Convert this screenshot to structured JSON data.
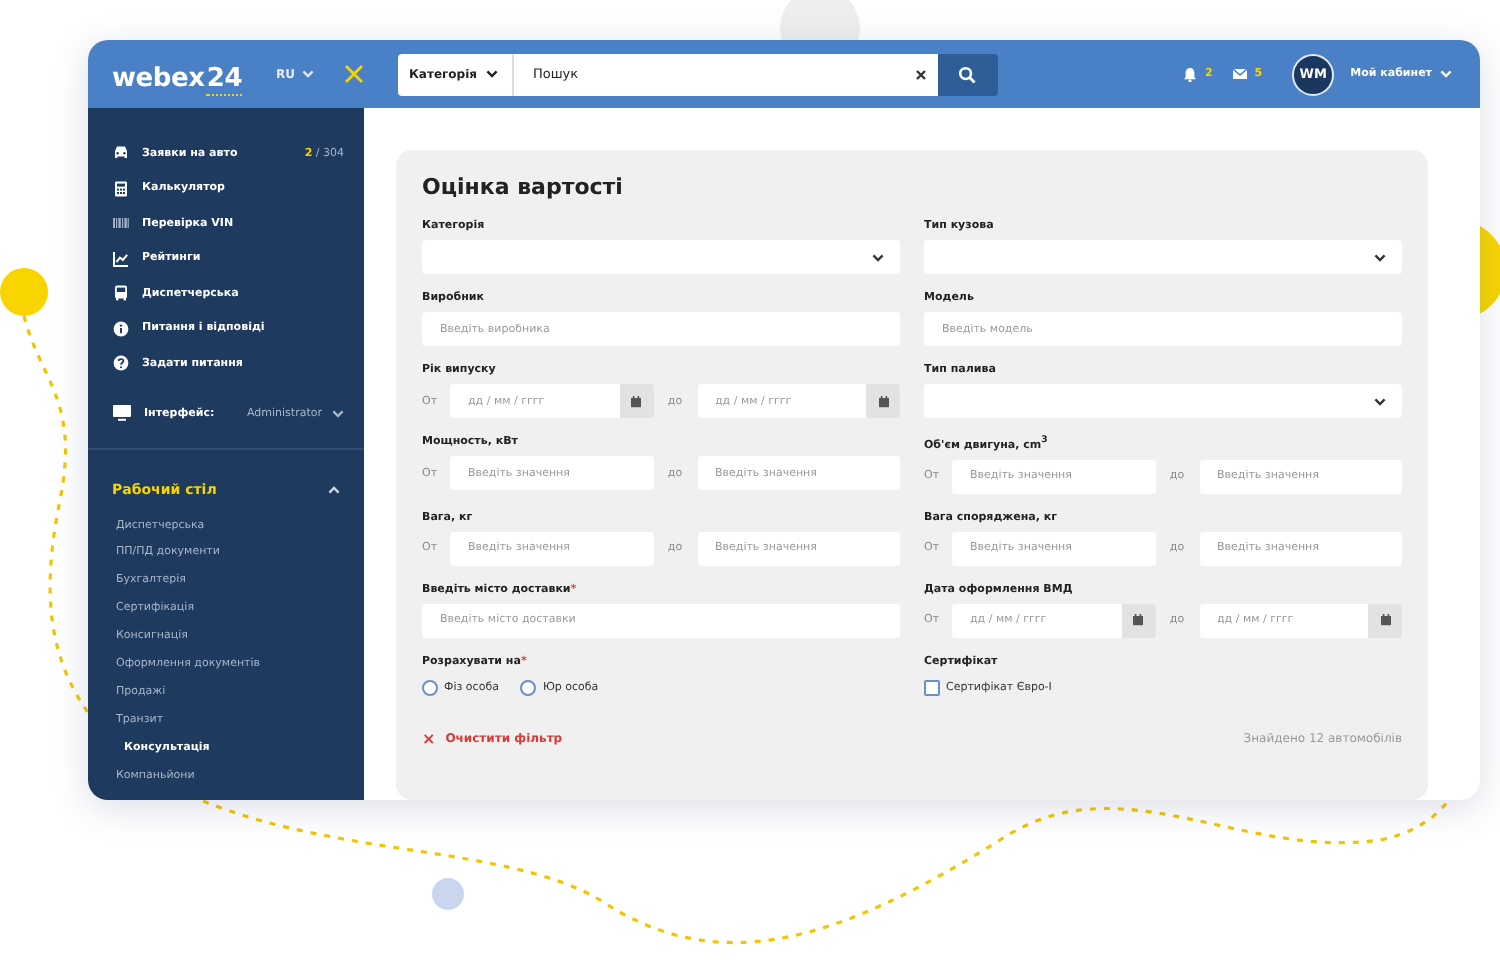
{
  "header": {
    "logo": {
      "text": "webex",
      "accent": "24"
    },
    "language": "RU",
    "search": {
      "category": "Категорія",
      "placeholder": "Пошук"
    },
    "notifications": [
      {
        "kind": "bell",
        "count": "2"
      },
      {
        "kind": "mail",
        "count": "5"
      }
    ],
    "user": {
      "initials": "WM",
      "label": "Мой кабинет"
    }
  },
  "sidebar": {
    "items": [
      {
        "label": "Заявки на авто",
        "count": "2",
        "total": "/ 304"
      },
      {
        "label": "Калькулятор"
      },
      {
        "label": "Перевірка VIN"
      },
      {
        "label": "Рейтинги"
      },
      {
        "label": "Диспетчерська"
      },
      {
        "label": "Питання і відповіді"
      },
      {
        "label": "Задати питання"
      }
    ],
    "interface": {
      "label": "Інтерфейс:",
      "value": "Administrator"
    },
    "section": {
      "title": "Рабочий стіл",
      "expanded": true,
      "items": [
        {
          "label": "Диспетчерська",
          "selected": false
        },
        {
          "label": "ПП/ПД документи",
          "selected": false
        },
        {
          "label": "Бухгалтерія",
          "selected": false
        },
        {
          "label": "Сертифікація",
          "selected": false
        },
        {
          "label": "Консигнація",
          "selected": false
        },
        {
          "label": "Оформлення документів",
          "selected": false
        },
        {
          "label": "Продажі",
          "selected": false
        },
        {
          "label": "Транзит",
          "selected": false
        },
        {
          "label": "Консультація",
          "selected": true
        },
        {
          "label": "Компаньйони",
          "selected": false
        }
      ]
    }
  },
  "form": {
    "title": "Оцінка вартості",
    "fields": [
      {
        "kind": "select",
        "label": "Категорія"
      },
      {
        "kind": "select",
        "label": "Тип кузова"
      },
      {
        "kind": "text",
        "label": "Виробник",
        "placeholder": "Введіть виробника"
      },
      {
        "kind": "text",
        "label": "Модель",
        "placeholder": "Введіть модель"
      },
      {
        "kind": "date-range",
        "label": "Рік випуску",
        "from_label": "От",
        "to_label": "до",
        "from_placeholder": "дд / мм / гггг",
        "to_placeholder": "дд / мм / гггг"
      },
      {
        "kind": "select",
        "label": "Тип палива"
      },
      {
        "kind": "range",
        "label": "Мощность, кВт",
        "from_label": "От",
        "to_label": "до",
        "from_placeholder": "Введіть значення",
        "to_placeholder": "Введіть значення"
      },
      {
        "kind": "range",
        "label": "Об'єм двигуна, cm$^{3}$",
        "from_label": "От",
        "to_label": "до",
        "from_placeholder": "Введіть значення",
        "to_placeholder": "Введіть значення"
      },
      {
        "kind": "range",
        "label": "Вага, кг",
        "from_label": "От",
        "to_label": "до",
        "from_placeholder": "Введіть значення",
        "to_placeholder": "Введіть значення"
      },
      {
        "kind": "range",
        "label": "Вага споряджена, кг",
        "from_label": "От",
        "to_label": "до",
        "from_placeholder": "Введіть значення",
        "to_placeholder": "Введіть значення"
      },
      {
        "kind": "text",
        "label": "Введіть місто доставки",
        "mark": "*",
        "placeholder": "Введіть місто доставки"
      },
      {
        "kind": "date-range",
        "label": "Дата оформлення ВМД",
        "from_label": "От",
        "to_label": "до",
        "from_placeholder": "дд / мм / гггг",
        "to_placeholder": "дд / мм / гггг"
      },
      {
        "kind": "radio",
        "label": "Розрахувати на",
        "mark": "*",
        "options": [
          {
            "label": "Фіз особа",
            "selected": false
          },
          {
            "label": "Юр особа",
            "selected": false
          }
        ]
      },
      {
        "kind": "checkbox",
        "label": "Сертифікат",
        "options": [
          {
            "label": "Сертифікат Євро-I",
            "checked": false
          }
        ]
      }
    ],
    "clear": "Очистити фільтр",
    "clear_icon": "×",
    "found": "Знайдено 12 автомобілів"
  }
}
